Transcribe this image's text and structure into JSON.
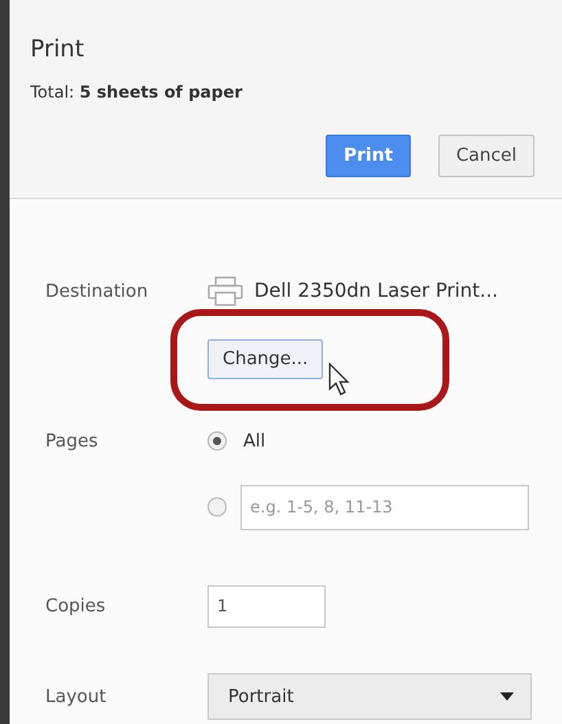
{
  "dialog": {
    "title": "Print",
    "total": "Total: **5 sheets of paper**"
  },
  "buttons": [
    {
      "label": "Print",
      "kind": "primary"
    },
    {
      "label": "Cancel",
      "kind": "secondary"
    }
  ],
  "destination": {
    "label": "Destination",
    "printer": "Dell 2350dn Laser Print...",
    "change_button": "Change..."
  },
  "pages": {
    "label": "Pages",
    "options": [
      {
        "kind": "all",
        "label": "All",
        "selected": true
      },
      {
        "kind": "range",
        "placeholder": "e.g. 1-5, 8, 11-13",
        "selected": false
      }
    ]
  },
  "copies": {
    "label": "Copies",
    "value": "1"
  },
  "layout": {
    "label": "Layout",
    "value": "Portrait"
  }
}
